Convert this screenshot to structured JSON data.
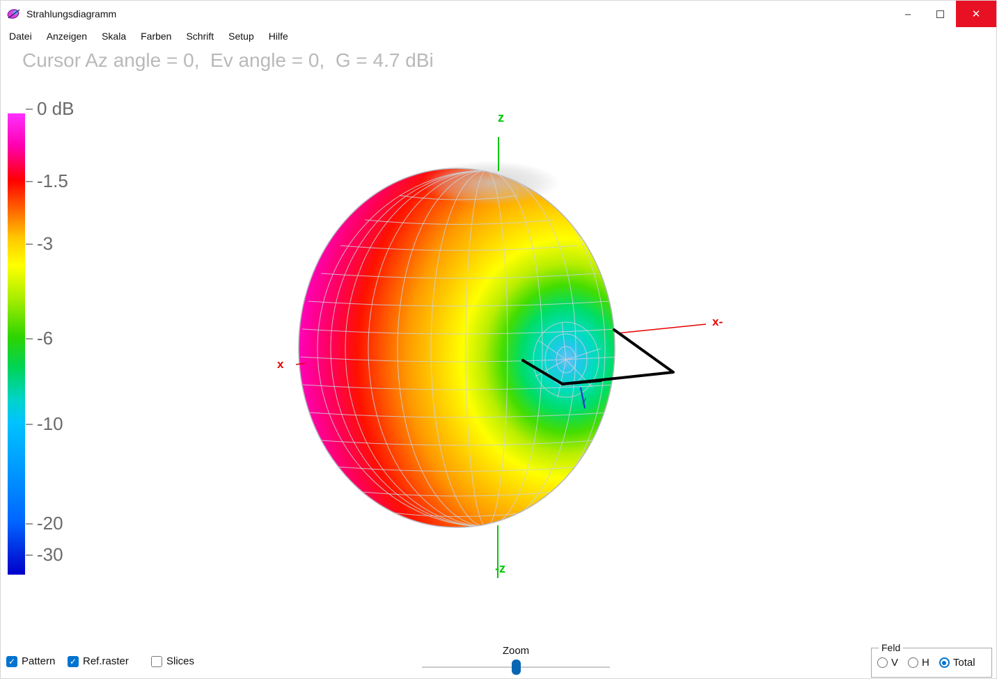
{
  "window": {
    "title": "Strahlungsdiagramm",
    "controls": {
      "minimize": "–",
      "close": "✕"
    }
  },
  "menu": {
    "items": [
      "Datei",
      "Anzeigen",
      "Skala",
      "Farben",
      "Schrift",
      "Setup",
      "Hilfe"
    ]
  },
  "status": "Cursor Az angle = 0,  Ev angle = 0,  G = 4.7 dBi",
  "colorbar": {
    "ticks": [
      "0 dB",
      "-1.5",
      "-3",
      "-6",
      "-10",
      "-20",
      "-30"
    ]
  },
  "axes": {
    "z_top": "z",
    "z_bottom": "-z",
    "x_left": "x",
    "x_right": "x-",
    "y": "y"
  },
  "footer": {
    "pattern_label": "Pattern",
    "refraster_label": "Ref.raster",
    "slices_label": "Slices",
    "zoom_label": "Zoom",
    "feld_label": "Feld",
    "option_v": "V",
    "option_h": "H",
    "option_total": "Total"
  },
  "chart_data": {
    "type": "3d-radiation-pattern",
    "title": "Strahlungsdiagramm",
    "cursor": {
      "az_angle_deg": 0,
      "ev_angle_deg": 0,
      "gain_dbi": 4.7
    },
    "colorbar_levels_db": [
      0,
      -1.5,
      -3,
      -6,
      -10,
      -20,
      -30
    ],
    "colorbar_colors": [
      "#ff30ff",
      "#ff0000",
      "#ffbb00",
      "#2ed400",
      "#00c3ff",
      "#0064ff",
      "#0000cc"
    ],
    "field_component": "Total",
    "layers": {
      "pattern": true,
      "ref_raster": true,
      "slices": false
    }
  }
}
